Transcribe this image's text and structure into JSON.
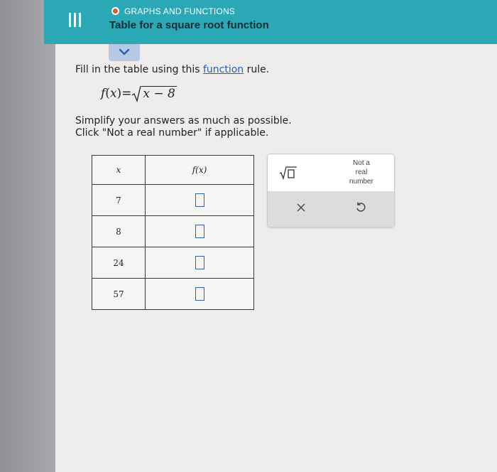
{
  "header": {
    "topic": "GRAPHS AND FUNCTIONS",
    "title": "Table for a square root function",
    "accent": "#2aa8b5",
    "topic_dot_color": "#e15a2c"
  },
  "instructions": {
    "prefix": "Fill in the table using this ",
    "link": "function",
    "suffix": " rule."
  },
  "formula": {
    "fn": "f",
    "var": "x",
    "radicand": "x − 8"
  },
  "notes": [
    "Simplify your answers as much as possible.",
    "Click \"Not a real number\" if applicable."
  ],
  "table": {
    "header_x": "x",
    "header_f": "f(x)",
    "rows": [
      {
        "x": "7"
      },
      {
        "x": "8"
      },
      {
        "x": "24"
      },
      {
        "x": "57"
      }
    ]
  },
  "keypad": {
    "not_real_line1": "Not a",
    "not_real_line2": "real",
    "not_real_line3": "number",
    "icons": [
      "square-root-icon",
      "clear-x-icon",
      "undo-icon"
    ]
  }
}
